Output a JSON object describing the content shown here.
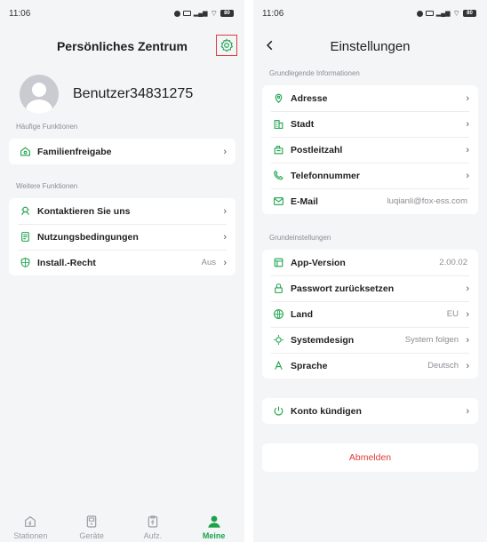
{
  "colors": {
    "accent": "#1ba34a",
    "danger": "#e03b3b",
    "highlight_box": "#e03b3b",
    "background": "#f4f5f7"
  },
  "left_screen": {
    "status": {
      "time": "11:06",
      "battery": "80"
    },
    "header": {
      "title": "Persönliches Zentrum",
      "settings_icon": "gear-icon"
    },
    "profile": {
      "username": "Benutzer34831275"
    },
    "common_section": {
      "label": "Häufige Funktionen",
      "items": [
        {
          "label": "Familienfreigabe",
          "icon": "family-share-icon"
        }
      ]
    },
    "more_section": {
      "label": "Weitere Funktionen",
      "items": [
        {
          "label": "Kontaktieren Sie uns",
          "icon": "contact-icon",
          "value": ""
        },
        {
          "label": "Nutzungsbedingungen",
          "icon": "document-icon",
          "value": ""
        },
        {
          "label": "Install.-Recht",
          "icon": "shield-icon",
          "value": "Aus"
        }
      ]
    },
    "tabbar": {
      "tabs": [
        {
          "label": "Stationen",
          "icon": "station-icon"
        },
        {
          "label": "Geräte",
          "icon": "device-icon"
        },
        {
          "label": "Aufz.",
          "icon": "record-icon"
        },
        {
          "label": "Meine",
          "icon": "user-icon",
          "active": true
        }
      ]
    }
  },
  "right_screen": {
    "status": {
      "time": "11:06",
      "battery": "80"
    },
    "header": {
      "title": "Einstellungen"
    },
    "basic_info": {
      "label": "Grundlegende Informationen",
      "items": [
        {
          "label": "Adresse",
          "icon": "location-icon",
          "value": ""
        },
        {
          "label": "Stadt",
          "icon": "building-icon",
          "value": ""
        },
        {
          "label": "Postleitzahl",
          "icon": "mailbox-icon",
          "value": ""
        },
        {
          "label": "Telefonnummer",
          "icon": "phone-icon",
          "value": ""
        },
        {
          "label": "E-Mail",
          "icon": "mail-icon",
          "value": "luqianli@fox-ess.com"
        }
      ]
    },
    "basic_settings": {
      "label": "Grundeinstellungen",
      "items": [
        {
          "label": "App-Version",
          "icon": "app-version-icon",
          "value": "2.00.02"
        },
        {
          "label": "Passwort zurücksetzen",
          "icon": "lock-icon",
          "value": ""
        },
        {
          "label": "Land",
          "icon": "globe-icon",
          "value": "EU"
        },
        {
          "label": "Systemdesign",
          "icon": "theme-icon",
          "value": "System folgen"
        },
        {
          "label": "Sprache",
          "icon": "language-icon",
          "value": "Deutsch"
        }
      ]
    },
    "account": {
      "label": "Konto kündigen",
      "icon": "power-icon"
    },
    "logout": {
      "label": "Abmelden"
    }
  }
}
